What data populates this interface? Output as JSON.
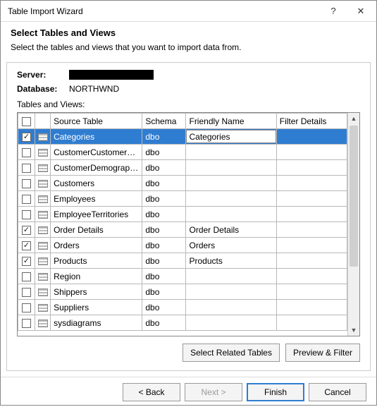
{
  "window": {
    "title": "Table Import Wizard",
    "help_glyph": "?",
    "close_glyph": "✕"
  },
  "header": {
    "heading": "Select Tables and Views",
    "description": "Select the tables and views that you want to import data from."
  },
  "meta": {
    "server_label": "Server:",
    "server_value_redacted": true,
    "database_label": "Database:",
    "database_value": "NORTHWND",
    "section_label": "Tables and Views:"
  },
  "columns": {
    "source": "Source Table",
    "schema": "Schema",
    "friendly": "Friendly Name",
    "filter": "Filter Details"
  },
  "header_checkbox_checked": false,
  "rows": [
    {
      "checked": true,
      "selected": true,
      "source": "Categories",
      "schema": "dbo",
      "friendly_edit": "Categories",
      "friendly": "",
      "filter": ""
    },
    {
      "checked": false,
      "selected": false,
      "source": "CustomerCustomerDemo",
      "schema": "dbo",
      "friendly": "",
      "filter": ""
    },
    {
      "checked": false,
      "selected": false,
      "source": "CustomerDemographics",
      "schema": "dbo",
      "friendly": "",
      "filter": ""
    },
    {
      "checked": false,
      "selected": false,
      "source": "Customers",
      "schema": "dbo",
      "friendly": "",
      "filter": ""
    },
    {
      "checked": false,
      "selected": false,
      "source": "Employees",
      "schema": "dbo",
      "friendly": "",
      "filter": ""
    },
    {
      "checked": false,
      "selected": false,
      "source": "EmployeeTerritories",
      "schema": "dbo",
      "friendly": "",
      "filter": ""
    },
    {
      "checked": true,
      "selected": false,
      "source": "Order Details",
      "schema": "dbo",
      "friendly": "Order Details",
      "filter": ""
    },
    {
      "checked": true,
      "selected": false,
      "source": "Orders",
      "schema": "dbo",
      "friendly": "Orders",
      "filter": ""
    },
    {
      "checked": true,
      "selected": false,
      "source": "Products",
      "schema": "dbo",
      "friendly": "Products",
      "filter": ""
    },
    {
      "checked": false,
      "selected": false,
      "source": "Region",
      "schema": "dbo",
      "friendly": "",
      "filter": ""
    },
    {
      "checked": false,
      "selected": false,
      "source": "Shippers",
      "schema": "dbo",
      "friendly": "",
      "filter": ""
    },
    {
      "checked": false,
      "selected": false,
      "source": "Suppliers",
      "schema": "dbo",
      "friendly": "",
      "filter": ""
    },
    {
      "checked": false,
      "selected": false,
      "source": "sysdiagrams",
      "schema": "dbo",
      "friendly": "",
      "filter": ""
    }
  ],
  "inset_buttons": {
    "select_related": "Select Related Tables",
    "preview_filter": "Preview & Filter"
  },
  "footer": {
    "back": "< Back",
    "next": "Next >",
    "finish": "Finish",
    "cancel": "Cancel"
  }
}
